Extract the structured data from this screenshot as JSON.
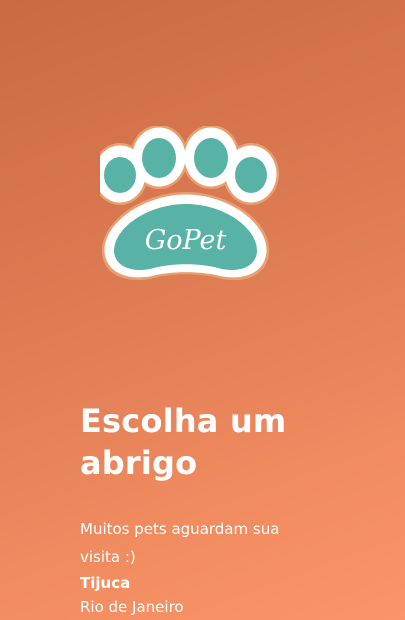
{
  "logo": {
    "text": "GoPet",
    "icon": "paw-icon",
    "colors": {
      "pad": "#58b2a6",
      "outline": "#ffffff",
      "edge": "#e8a070"
    }
  },
  "onboarding": {
    "title": "Escolha um abrigo",
    "subtitle": "Muitos pets aguardam sua visita :)",
    "city": "Tijuca",
    "region": "Rio de Janeiro"
  },
  "theme": {
    "background_start": "#c96a43",
    "background_end": "#fb9569",
    "text": "#ffffff"
  }
}
